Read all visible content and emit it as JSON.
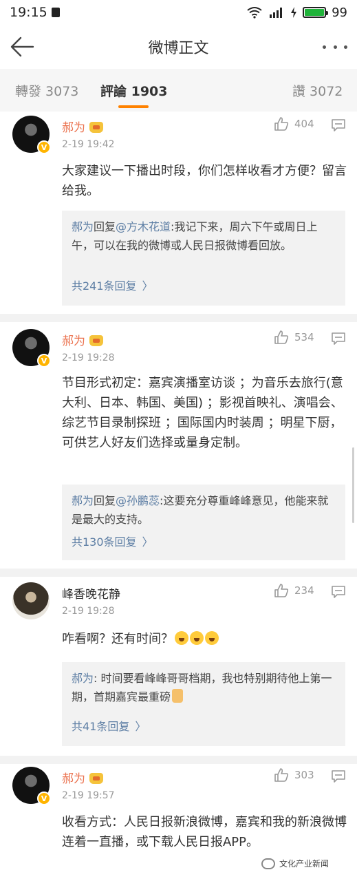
{
  "status": {
    "time": "19:15",
    "battery": "99",
    "battery_level": 0.99
  },
  "nav": {
    "title": "微博正文"
  },
  "tabs": [
    {
      "label": "轉發 3073"
    },
    {
      "label": "評論 1903"
    },
    {
      "label": "讚 3072"
    }
  ],
  "comments": [
    {
      "author": "郝为",
      "time": "2-19 19:42",
      "likes": "404",
      "text": "大家建议一下播出时段，你们怎样收看才方便？留言给我。",
      "sub": {
        "author": "郝为",
        "prefix": "回复",
        "at": "@方木花道",
        "body": ":我记下来，周六下午或周日上午，可以在我的微博或人民日报微博看回放。",
        "more": "共241条回复"
      }
    },
    {
      "author": "郝为",
      "time": "2-19 19:28",
      "likes": "534",
      "text": "节目形式初定：嘉宾演播室访谈 ；为音乐去旅行(意大利、日本、韩国、美国) ；影视首映礼、演唱会、综艺节目录制探班 ；国际国内时装周 ；明星下厨，可供艺人好友们选择或量身定制。",
      "sub": {
        "author": "郝为",
        "prefix": "回复",
        "at": "@孙鹏蕊",
        "body": ":这要充分尊重峰峰意见，他能来就是最大的支持。",
        "more": "共130条回复"
      }
    },
    {
      "author": "峰香晚花静",
      "time": "2-19 19:28",
      "likes": "234",
      "text": "咋看啊？还有时间？",
      "sub": {
        "author": "郝为",
        "prefix": "",
        "at": "",
        "body": ": 时间要看峰峰哥哥档期，我也特别期待他上第一期，首期嘉宾最重磅",
        "more": "共41条回复"
      }
    },
    {
      "author": "郝为",
      "time": "2-19 19:57",
      "likes": "303",
      "text": "收看方式：人民日报新浪微博，嘉宾和我的新浪微博连着一直播，或下载人民日报APP。"
    }
  ],
  "watermark": "文化产业新闻",
  "colors": {
    "accent": "#ff8200",
    "author": "#eb7350",
    "link": "#5d7ea4"
  }
}
